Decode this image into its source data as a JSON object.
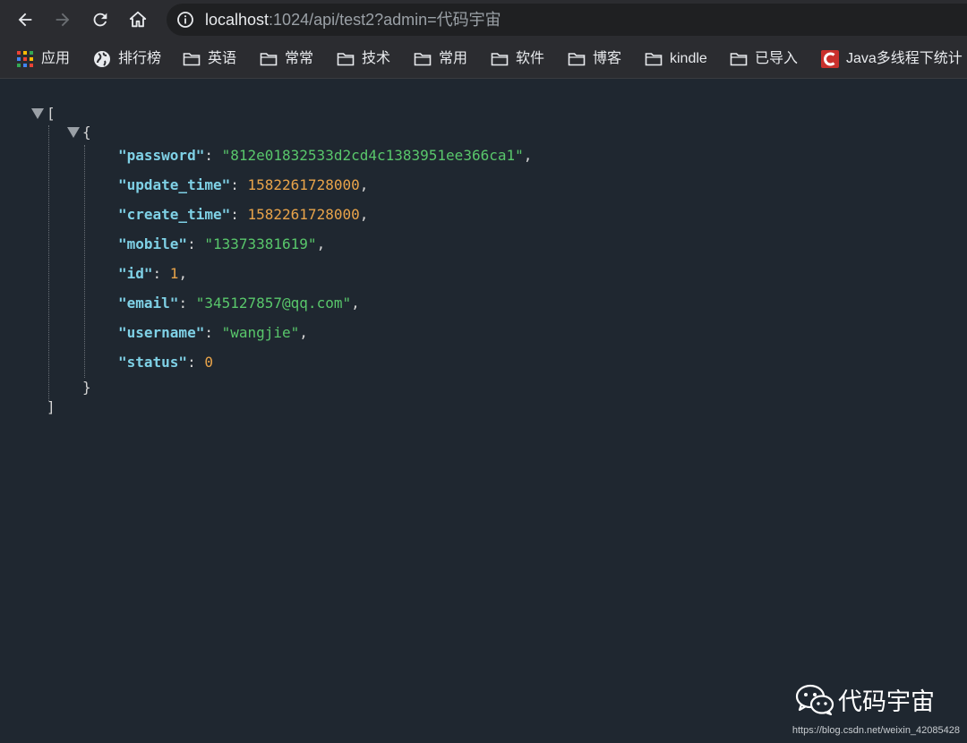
{
  "browser": {
    "url_host": "localhost",
    "url_path": ":1024/api/test2?admin=代码宇宙",
    "bookmarks": [
      {
        "label": "应用",
        "icon": "apps-grid-icon"
      },
      {
        "label": "排行榜",
        "icon": "globe-icon"
      },
      {
        "label": "英语",
        "icon": "folder-icon"
      },
      {
        "label": "常常",
        "icon": "folder-icon"
      },
      {
        "label": "技术",
        "icon": "folder-icon"
      },
      {
        "label": "常用",
        "icon": "folder-icon"
      },
      {
        "label": "软件",
        "icon": "folder-icon"
      },
      {
        "label": "博客",
        "icon": "folder-icon"
      },
      {
        "label": "kindle",
        "icon": "folder-icon"
      },
      {
        "label": "已导入",
        "icon": "folder-icon"
      },
      {
        "label": "Java多线程下统计",
        "icon": "csdn-icon"
      }
    ]
  },
  "json": {
    "open_bracket": "[",
    "close_bracket": "]",
    "open_brace": "{",
    "close_brace": "}",
    "entries": [
      {
        "key": "\"password\"",
        "value": "\"812e01832533d2cd4c1383951ee366ca1\"",
        "type": "string",
        "comma": ","
      },
      {
        "key": "\"update_time\"",
        "value": "1582261728000",
        "type": "number",
        "comma": ","
      },
      {
        "key": "\"create_time\"",
        "value": "1582261728000",
        "type": "number",
        "comma": ","
      },
      {
        "key": "\"mobile\"",
        "value": "\"13373381619\"",
        "type": "string",
        "comma": ","
      },
      {
        "key": "\"id\"",
        "value": "1",
        "type": "number",
        "comma": ","
      },
      {
        "key": "\"email\"",
        "value": "\"345127857@qq.com\"",
        "type": "string",
        "comma": ","
      },
      {
        "key": "\"username\"",
        "value": "\"wangjie\"",
        "type": "string",
        "comma": ","
      },
      {
        "key": "\"status\"",
        "value": "0",
        "type": "number",
        "comma": ""
      }
    ]
  },
  "watermark": {
    "text": "代码宇宙",
    "source": "https://blog.csdn.net/weixin_42085428"
  },
  "colors": {
    "background": "#1f2730",
    "key": "#7fd1e6",
    "string": "#59c76b",
    "number": "#e9a44a"
  }
}
